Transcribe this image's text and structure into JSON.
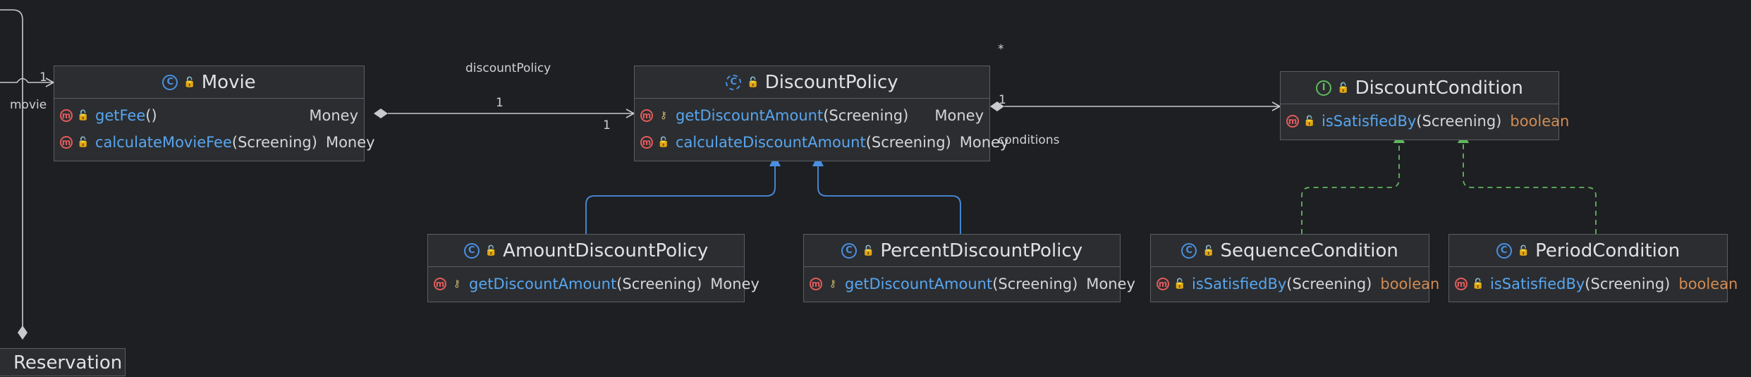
{
  "colors": {
    "background": "#1e1f22",
    "box": "#2b2d30",
    "method_name": "#58a6f0",
    "boolean_type": "#d28b52",
    "inheritance_arrow": "#4a90e2",
    "realization_arrow": "#5fb85f",
    "method_badge": "#e25b5b"
  },
  "classes": {
    "movie": {
      "name": "Movie",
      "kind_icon": "C",
      "methods": [
        {
          "name": "getFee",
          "params": "()",
          "type": "Money"
        },
        {
          "name": "calculateMovieFee",
          "params": "(Screening)",
          "type": "Money"
        }
      ]
    },
    "discount_policy": {
      "name": "DiscountPolicy",
      "kind_icon": "C",
      "methods": [
        {
          "name": "getDiscountAmount",
          "params": "(Screening)",
          "type": "Money"
        },
        {
          "name": "calculateDiscountAmount",
          "params": "(Screening)",
          "type": "Money"
        }
      ]
    },
    "discount_condition": {
      "name": "DiscountCondition",
      "kind_icon": "I",
      "methods": [
        {
          "name": "isSatisfiedBy",
          "params": "(Screening)",
          "type": "boolean"
        }
      ]
    },
    "amount_discount_policy": {
      "name": "AmountDiscountPolicy",
      "kind_icon": "C",
      "methods": [
        {
          "name": "getDiscountAmount",
          "params": "(Screening)",
          "type": "Money"
        }
      ]
    },
    "percent_discount_policy": {
      "name": "PercentDiscountPolicy",
      "kind_icon": "C",
      "methods": [
        {
          "name": "getDiscountAmount",
          "params": "(Screening)",
          "type": "Money"
        }
      ]
    },
    "sequence_condition": {
      "name": "SequenceCondition",
      "kind_icon": "C",
      "methods": [
        {
          "name": "isSatisfiedBy",
          "params": "(Screening)",
          "type": "boolean"
        }
      ]
    },
    "period_condition": {
      "name": "PeriodCondition",
      "kind_icon": "C",
      "methods": [
        {
          "name": "isSatisfiedBy",
          "params": "(Screening)",
          "type": "boolean"
        }
      ]
    },
    "reservation": {
      "name": "Reservation"
    }
  },
  "edge_labels": {
    "movie_role": "movie",
    "movie_mult": "1",
    "discount_policy_role": "discountPolicy",
    "discount_policy_mult_a": "1",
    "discount_policy_mult_b": "1",
    "conditions_role": "conditions",
    "conditions_mult_1": "1",
    "conditions_mult_star": "*"
  }
}
